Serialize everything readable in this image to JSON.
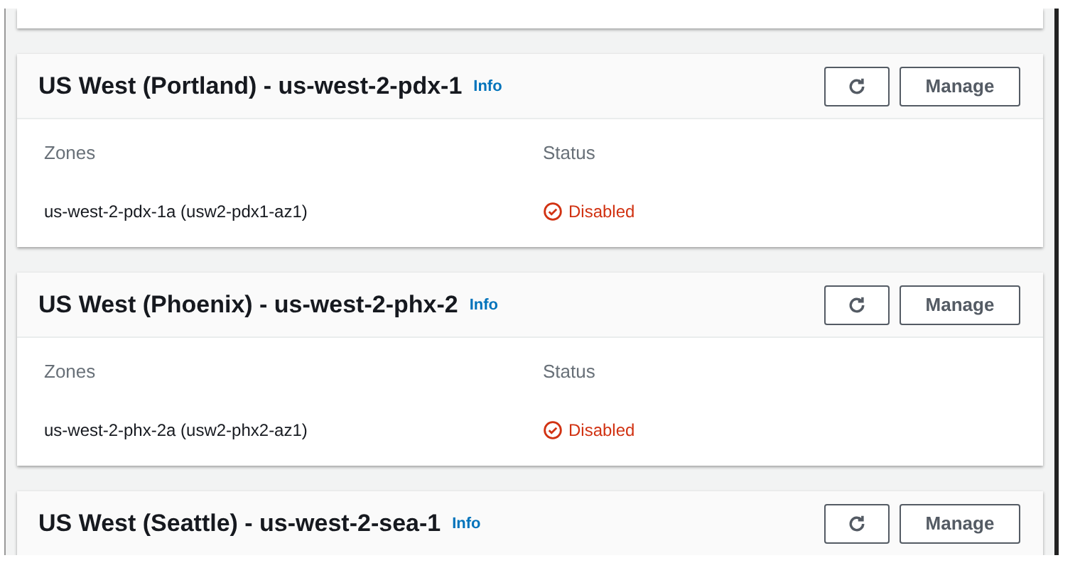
{
  "regions": [
    {
      "title": "US West (Portland) - us-west-2-pdx-1",
      "info": "Info",
      "manage": "Manage",
      "columns": [
        "Zones",
        "Status"
      ],
      "zones": [
        {
          "zone": "us-west-2-pdx-1a (usw2-pdx1-az1)",
          "status": "Disabled"
        }
      ]
    },
    {
      "title": "US West (Phoenix) - us-west-2-phx-2",
      "info": "Info",
      "manage": "Manage",
      "columns": [
        "Zones",
        "Status"
      ],
      "zones": [
        {
          "zone": "us-west-2-phx-2a (usw2-phx2-az1)",
          "status": "Disabled"
        }
      ]
    },
    {
      "title": "US West (Seattle) - us-west-2-sea-1",
      "info": "Info",
      "manage": "Manage"
    }
  ]
}
